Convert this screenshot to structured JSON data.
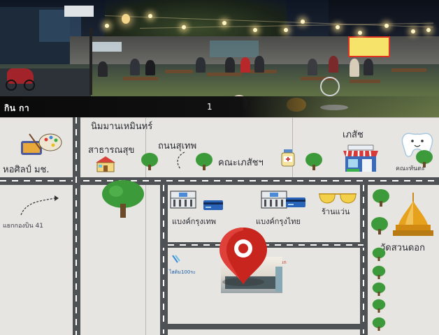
{
  "photo": {
    "caption_left": "กิน กา",
    "caption_right": "1"
  },
  "map": {
    "labels": {
      "nimman": "นิมมานเหมินทร์",
      "health": "สาธารณสุข",
      "suthep_road": "ถนนสุเทพ",
      "pharmacy_faculty": "คณะเภสัชฯ",
      "pharmacy": "เภสัช",
      "art_museum": "หอศิลป์ มช.",
      "dentistry_faculty": "คณะทันตะ",
      "soi_41": "แยกกองบิน 41",
      "bangkok_bank": "แบงค์กรุงเทพ",
      "krungthai_bank": "แบงค์กรุงไทย",
      "optical_shop": "ร้านแว่น",
      "wat_suan_dok": "วัดสวนดอก",
      "small_shop": "ไฮติม100ระ",
      "dok_label": "นดอก"
    },
    "colors": {
      "road": "#4f5254",
      "background": "#e7e5e1",
      "pin": "#c8251f",
      "tree": "#3d9a3a",
      "pagoda": "#e6a21d"
    },
    "icons": [
      "art-palette-icon",
      "house-icon",
      "medicine-bottle-icon",
      "pharmacy-shop-icon",
      "tooth-icon",
      "bank-icon",
      "credit-card-icon",
      "sunglasses-icon",
      "pagoda-icon",
      "location-pin-icon",
      "tree-icon",
      "map-dashed-arrow-icon"
    ]
  }
}
